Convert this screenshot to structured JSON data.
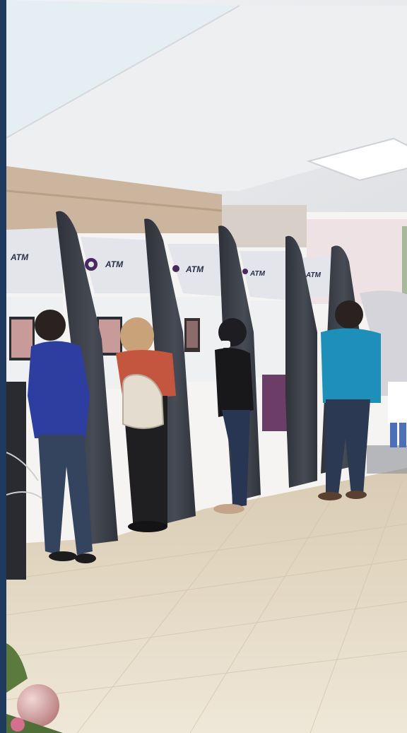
{
  "scene": {
    "kiosks": [
      {
        "brand": "ATM"
      },
      {
        "brand": "ATM"
      },
      {
        "brand": "ATM"
      },
      {
        "brand": "ATM"
      },
      {
        "brand": "ATM"
      }
    ],
    "colors": {
      "ceiling": "#e9ebee",
      "wall_wood": "#cdb8a2",
      "kiosk_dark": "#3d4049",
      "kiosk_hood": "#e3e5ea",
      "floor": "#e2d6bf",
      "brand_purple": "#4a2a5e",
      "frame_border": "#1e3a5f"
    }
  }
}
